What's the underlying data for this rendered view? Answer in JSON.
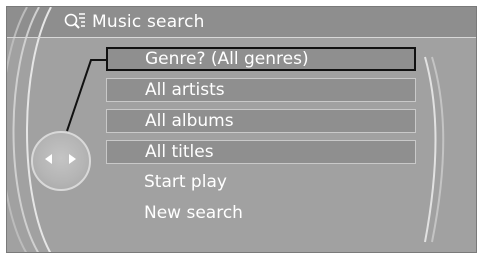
{
  "header": {
    "title": "Music search",
    "icon": "music-search-icon"
  },
  "controller": {
    "icon": "controller-knob-icon"
  },
  "menu": {
    "selected_index": 0,
    "items": [
      {
        "label": "Genre? (All genres)"
      },
      {
        "label": "All artists"
      },
      {
        "label": "All albums"
      },
      {
        "label": "All titles"
      },
      {
        "label": "Start play"
      },
      {
        "label": "New search"
      }
    ]
  },
  "colors": {
    "screen_bg": "#a1a1a1",
    "header_bg": "#8e8e8e",
    "field_bg": "#8f8f8f",
    "text": "#ffffff",
    "selection_border": "#111111"
  }
}
